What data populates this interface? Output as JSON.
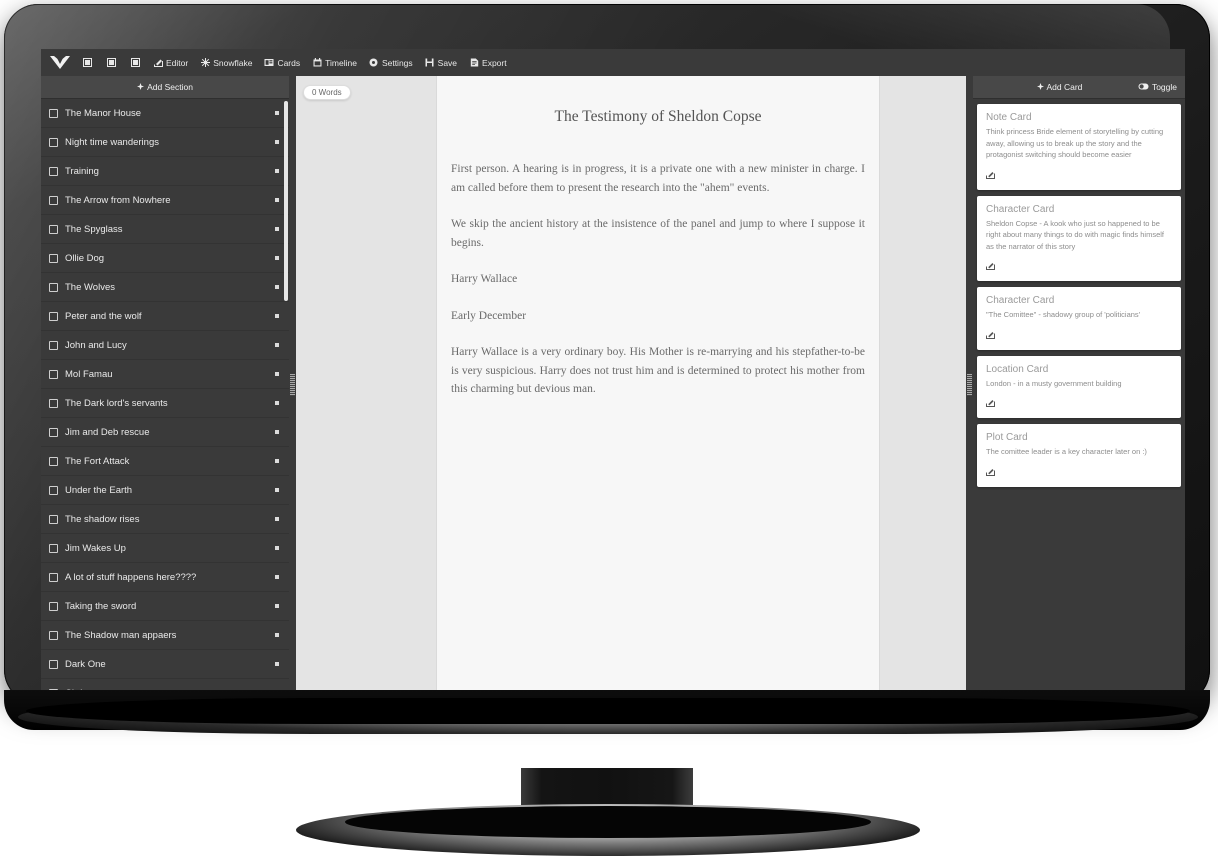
{
  "app": {
    "logo_icon": "butterfly-logo-icon",
    "toolbar": {
      "icon_buttons": [
        {
          "name": "layout-left-icon",
          "glyph": "▣"
        },
        {
          "name": "layout-center-icon",
          "glyph": "▣"
        },
        {
          "name": "layout-right-icon",
          "glyph": "▣"
        }
      ],
      "items": [
        {
          "label": "Editor",
          "icon": "edit-pencil-icon",
          "glyph": "✎"
        },
        {
          "label": "Snowflake",
          "icon": "snowflake-icon",
          "glyph": "❄"
        },
        {
          "label": "Cards",
          "icon": "cards-icon",
          "glyph": "▤"
        },
        {
          "label": "Timeline",
          "icon": "calendar-icon",
          "glyph": "Ὄ5"
        },
        {
          "label": "Settings",
          "icon": "gear-icon",
          "glyph": "⚙"
        },
        {
          "label": "Save",
          "icon": "save-disk-icon",
          "glyph": "ὋE"
        },
        {
          "label": "Export",
          "icon": "file-export-icon",
          "glyph": "Ὄ4"
        }
      ]
    }
  },
  "sidebar": {
    "add_section_label": "Add Section",
    "add_section_icon": "plus-icon",
    "items": [
      {
        "label": "The Manor House"
      },
      {
        "label": "Night time wanderings"
      },
      {
        "label": "Training"
      },
      {
        "label": "The Arrow from Nowhere"
      },
      {
        "label": "The Spyglass"
      },
      {
        "label": "Ollie Dog"
      },
      {
        "label": "The Wolves"
      },
      {
        "label": "Peter and the wolf"
      },
      {
        "label": "John and Lucy"
      },
      {
        "label": "Mol Famau"
      },
      {
        "label": "The Dark lord's servants"
      },
      {
        "label": "Jim and Deb rescue"
      },
      {
        "label": "The Fort Attack"
      },
      {
        "label": "Under the Earth"
      },
      {
        "label": "The shadow rises"
      },
      {
        "label": "Jim Wakes Up"
      },
      {
        "label": "A lot of stuff happens here????"
      },
      {
        "label": "Taking the sword"
      },
      {
        "label": "The Shadow man appaers"
      },
      {
        "label": "Dark One"
      },
      {
        "label": "Christmas"
      }
    ]
  },
  "editor": {
    "word_count": "0 Words",
    "title": "The Testimony of Sheldon Copse",
    "paragraphs": [
      "First person. A hearing is in progress, it is  a private one with a new minister in charge. I am called before them to present the research into the \"ahem\" events.",
      "We skip the ancient history at the insistence of the panel and jump to where I suppose it begins.",
      "Harry Wallace",
      "Early December",
      "Harry Wallace is a very ordinary boy. His Mother is re-marrying and his stepfather-to-be is very suspicious.  Harry does not trust him and is determined to protect his mother from this charming but devious man."
    ]
  },
  "cards_panel": {
    "add_card_label": "Add Card",
    "add_card_icon": "plus-icon",
    "toggle_label": "Toggle",
    "toggle_icon": "toggle-switch-icon",
    "edit_icon": "edit-square-icon",
    "cards": [
      {
        "title": "Note Card",
        "body": "Think princess Bride element of storytelling by cutting away, allowing us to break up the story and the protagonist switching should become easier"
      },
      {
        "title": "Character Card",
        "body": "Sheldon Copse - A kook who just so happened to be right about many things to do with magic finds himself as the narrator of this story"
      },
      {
        "title": "Character Card",
        "body": "\"The Comittee\" - shadowy group of 'politicians'"
      },
      {
        "title": "Location Card",
        "body": "London - in a musty government building"
      },
      {
        "title": "Plot Card",
        "body": "The comittee leader is a key character later on :)"
      }
    ]
  },
  "colors": {
    "chrome": "#3a3a3a",
    "header": "#484848",
    "editor_bg": "#e4e4e4",
    "page_bg": "#f7f7f7",
    "text_light": "#eaeaea",
    "doc_text": "#6a6a6a"
  }
}
